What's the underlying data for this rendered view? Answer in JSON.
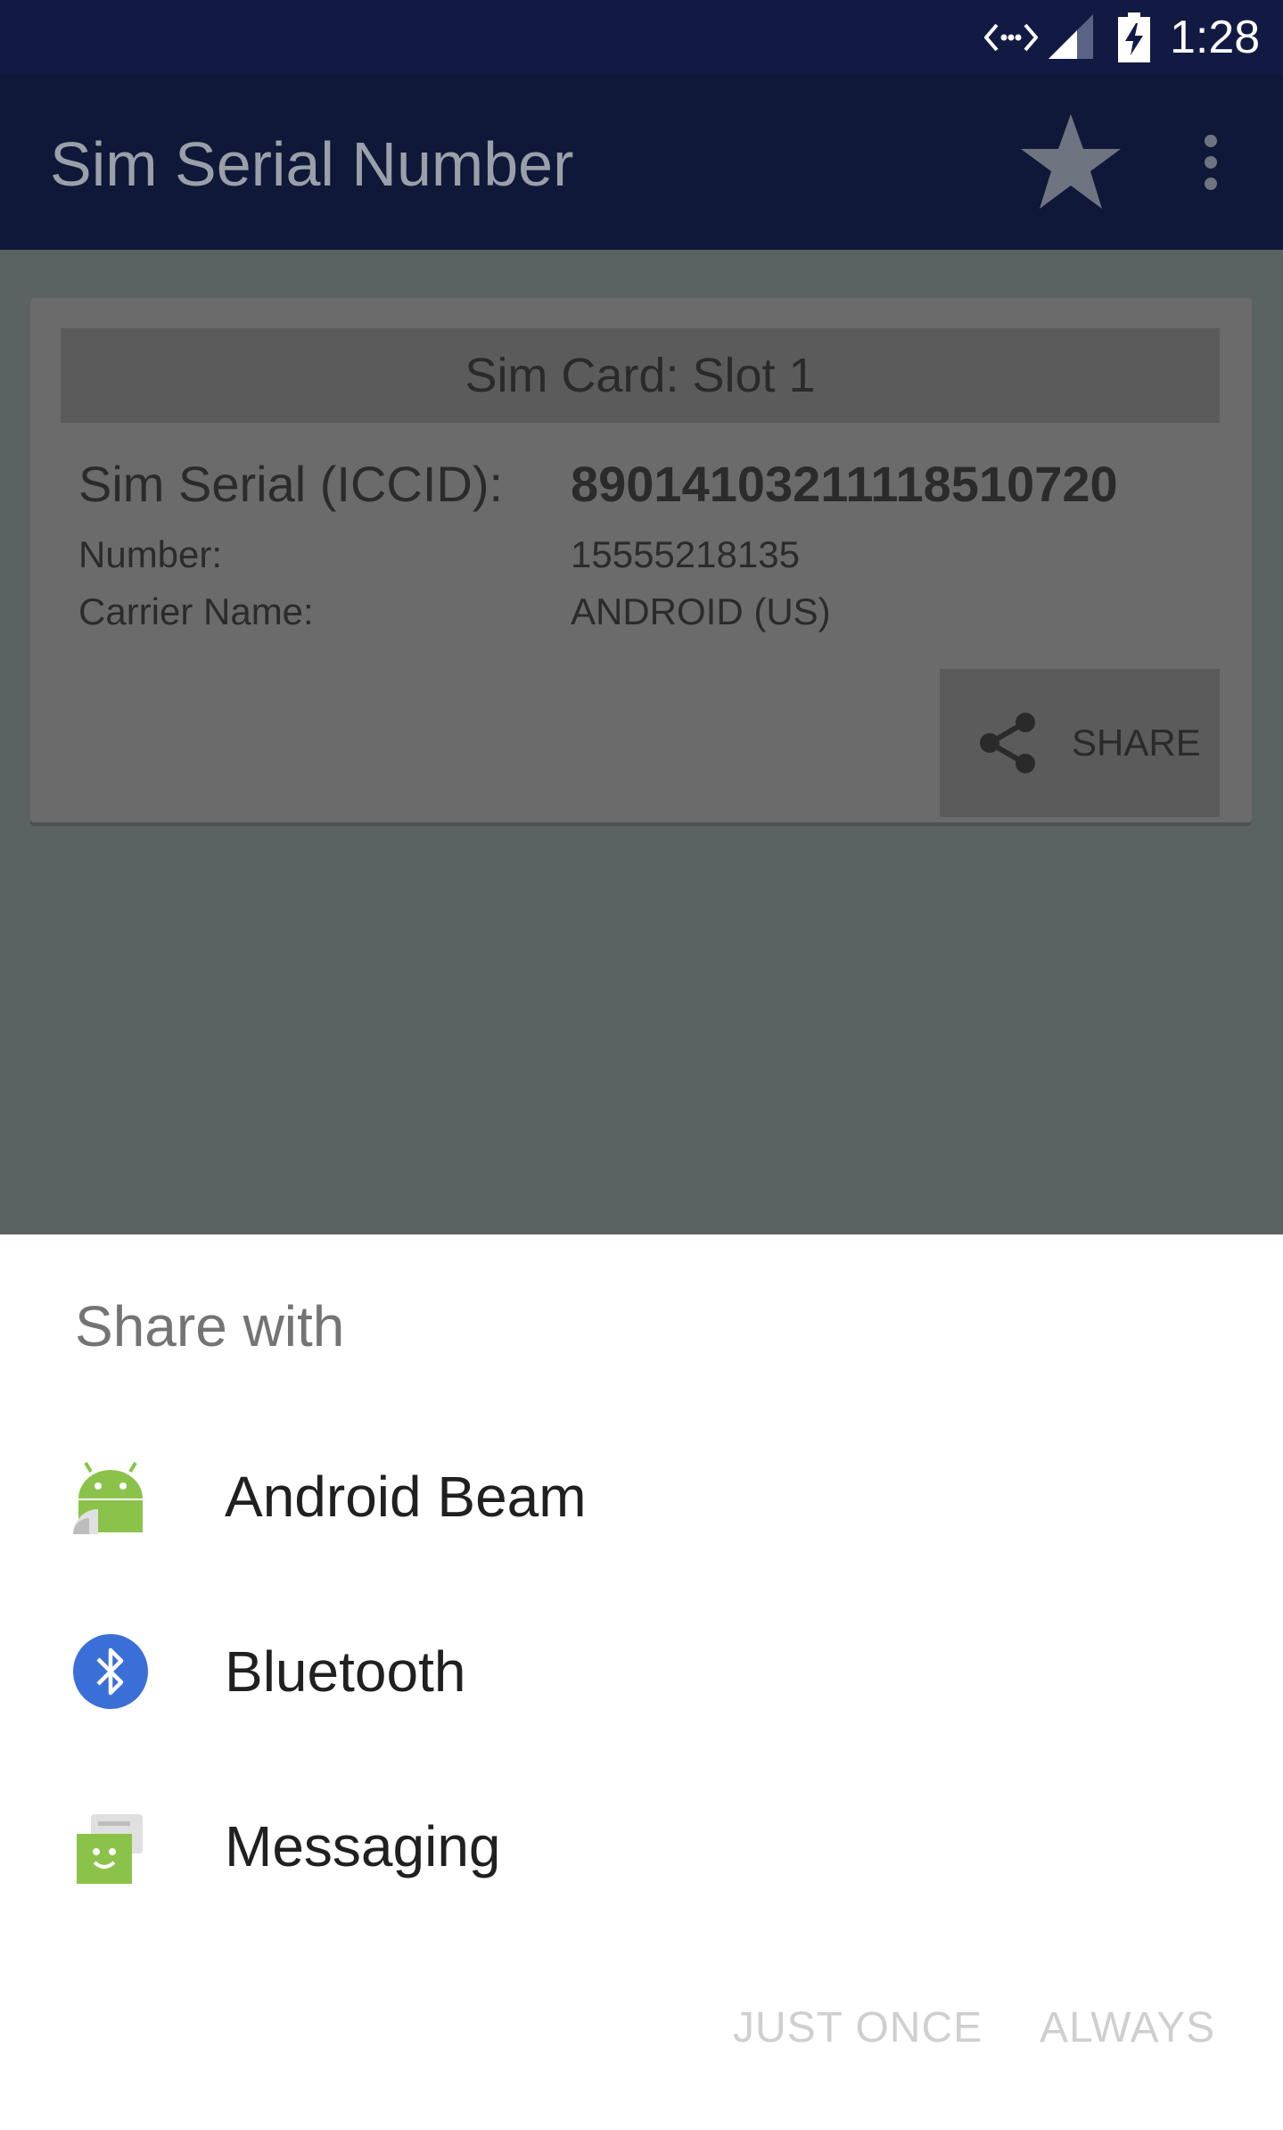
{
  "status_bar": {
    "time": "1:28",
    "icons": [
      "data-sync-icon",
      "signal-icon",
      "battery-charging-icon"
    ]
  },
  "app_bar": {
    "title": "Sim Serial Number",
    "icons": [
      "star-icon",
      "overflow-menu-icon"
    ]
  },
  "sim_card": {
    "header": "Sim Card: Slot 1",
    "iccid_label": "Sim Serial (ICCID):",
    "iccid_value": "89014103211118510720",
    "number_label": "Number:",
    "number_value": "15555218135",
    "carrier_label": "Carrier Name:",
    "carrier_value": "ANDROID (US)",
    "share_label": "SHARE"
  },
  "share_sheet": {
    "title": "Share with",
    "options": [
      {
        "label": "Android Beam",
        "icon": "android-beam-icon"
      },
      {
        "label": "Bluetooth",
        "icon": "bluetooth-icon"
      },
      {
        "label": "Messaging",
        "icon": "messaging-icon"
      }
    ],
    "just_once_label": "JUST ONCE",
    "always_label": "ALWAYS"
  },
  "colors": {
    "status_bar": "#121a44",
    "app_bar": "#0f1838",
    "scrim": "#5b6262",
    "card": "#6b6b6b",
    "bluetooth_blue": "#3b6fd8",
    "android_green": "#8bc34a",
    "disabled_button": "#cfcfcf"
  }
}
